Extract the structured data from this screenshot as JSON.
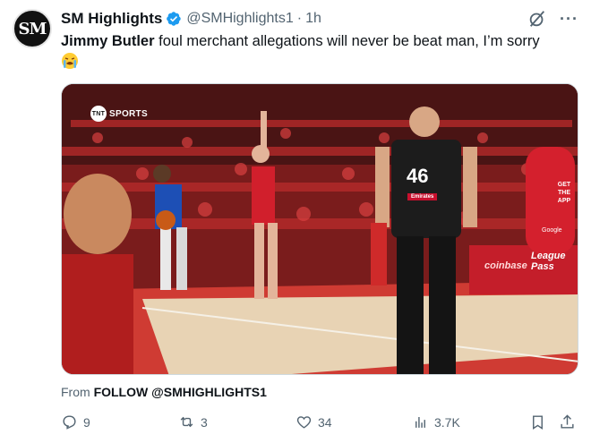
{
  "author": {
    "avatar_text": "SM",
    "name": "SM Highlights",
    "handle": "@SMHighlights1",
    "separator": "·",
    "time": "1h"
  },
  "tweet": {
    "bold_text": "Jimmy Butler",
    "text": " foul merchant allegations will never be beat man, I’m sorry",
    "emoji": "😭"
  },
  "media": {
    "broadcaster": "SPORTS",
    "broadcaster_badge": "TNT",
    "referee_number": "46",
    "referee_patch": "Emirates",
    "courtside_ad_1": "coinbase",
    "courtside_ad_2": "League Pass",
    "ad_google": "Google",
    "ad_getapp": "GET THE APP"
  },
  "attribution": {
    "prefix": "From ",
    "source": "FOLLOW @SMHIGHLIGHTS1"
  },
  "actions": {
    "replies": "9",
    "reposts": "3",
    "likes": "34",
    "views": "3.7K"
  },
  "colors": {
    "verified": "#1d9bf0",
    "text_secondary": "#536471",
    "text_primary": "#0f1419"
  }
}
